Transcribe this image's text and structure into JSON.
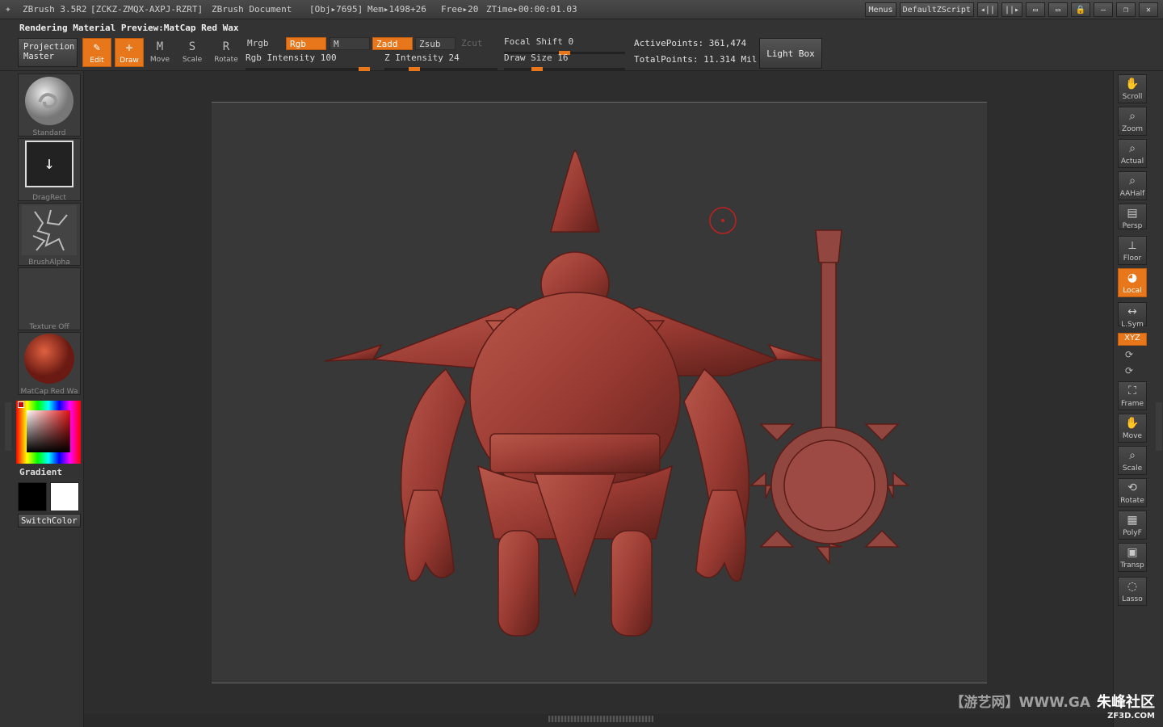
{
  "titlebar": {
    "app": "ZBrush 3.5R2",
    "serial": "[ZCKZ-ZMQX-AXPJ-RZRT]",
    "doc": "ZBrush Document",
    "obj": "[Obj▸7695]",
    "mem": "Mem▸1498+26",
    "free": "Free▸20",
    "ztime": "ZTime▸00:00:01.03",
    "menus": "Menus",
    "script": "DefaultZScript"
  },
  "status": {
    "text": "Rendering Material Preview:MatCap Red Wax"
  },
  "toolbar": {
    "projection_master": "Projection Master",
    "edit": "Edit",
    "draw": "Draw",
    "move": "Move",
    "scale": "Scale",
    "rotate": "Rotate",
    "mrgb": "Mrgb",
    "rgb": "Rgb",
    "m": "M",
    "zadd": "Zadd",
    "zsub": "Zsub",
    "zcut": "Zcut",
    "rgb_intensity_label": "Rgb Intensity",
    "rgb_intensity_value": "100",
    "z_intensity_label": "Z Intensity",
    "z_intensity_value": "24",
    "focal_shift_label": "Focal Shift",
    "focal_shift_value": "0",
    "draw_size_label": "Draw Size",
    "draw_size_value": "16",
    "active_points_label": "ActivePoints:",
    "active_points": "361,474",
    "total_points_label": "TotalPoints:",
    "total_points": "11.314 Mil",
    "light_box": "Light Box"
  },
  "left_tray": {
    "brush": "Standard",
    "stroke": "DragRect",
    "alpha": "BrushAlpha",
    "texture": "Texture Off",
    "material": "MatCap Red Wa",
    "gradient": "Gradient",
    "switch_color": "SwitchColor"
  },
  "right_tray": {
    "scroll": "Scroll",
    "zoom": "Zoom",
    "actual": "Actual",
    "aahalf": "AAHalf",
    "persp": "Persp",
    "floor": "Floor",
    "local": "Local",
    "lsym": "L.Sym",
    "xyz": "XYZ",
    "frame": "Frame",
    "move": "Move",
    "scale": "Scale",
    "rotate": "Rotate",
    "polyf": "PolyF",
    "transp": "Transp",
    "lasso": "Lasso"
  },
  "watermark": {
    "left": "【游艺网】WWW.GA",
    "right": "朱峰社区",
    "sub": "ZF3D.COM"
  },
  "colors": {
    "accent": "#e8761a",
    "model": "#9a3b33"
  },
  "sliders": {
    "rgb_intensity": 1.0,
    "z_intensity": 0.24,
    "focal_shift": 0.5,
    "draw_size": 0.25
  }
}
